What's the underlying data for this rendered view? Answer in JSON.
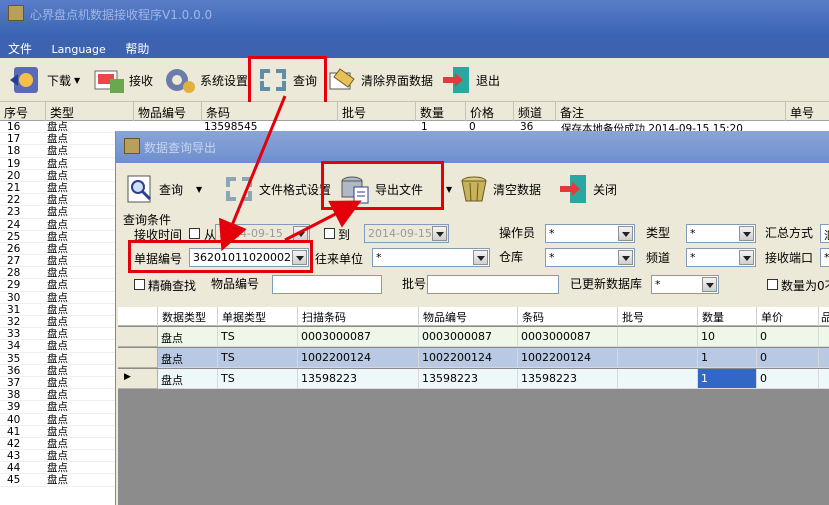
{
  "app": {
    "title": "心界盘点机数据接收程序V1.0.0.0"
  },
  "menu": [
    {
      "label": "文件"
    },
    {
      "label": "Language"
    },
    {
      "label": "帮助"
    }
  ],
  "toolbar": {
    "download": "下载",
    "receive": "接收",
    "settings": "系统设置",
    "query": "查询",
    "clear_ui": "清除界面数据",
    "exit": "退出"
  },
  "main_grid": {
    "columns": [
      "序号",
      "类型",
      "物品编号",
      "条码",
      "批号",
      "数量",
      "价格",
      "频道",
      "备注",
      "单号"
    ],
    "first_row": {
      "barcode": "13598545",
      "qty": "1",
      "price": "0",
      "channel": "36",
      "note": "保存本地备份成功 2014-09-15 15:20"
    },
    "rows": [
      {
        "n": "16",
        "t": "盘点"
      },
      {
        "n": "17",
        "t": "盘点"
      },
      {
        "n": "18",
        "t": "盘点"
      },
      {
        "n": "19",
        "t": "盘点"
      },
      {
        "n": "20",
        "t": "盘点"
      },
      {
        "n": "21",
        "t": "盘点"
      },
      {
        "n": "22",
        "t": "盘点"
      },
      {
        "n": "23",
        "t": "盘点"
      },
      {
        "n": "24",
        "t": "盘点"
      },
      {
        "n": "25",
        "t": "盘点"
      },
      {
        "n": "26",
        "t": "盘点"
      },
      {
        "n": "27",
        "t": "盘点"
      },
      {
        "n": "28",
        "t": "盘点"
      },
      {
        "n": "29",
        "t": "盘点"
      },
      {
        "n": "30",
        "t": "盘点"
      },
      {
        "n": "31",
        "t": "盘点"
      },
      {
        "n": "32",
        "t": "盘点"
      },
      {
        "n": "33",
        "t": "盘点"
      },
      {
        "n": "34",
        "t": "盘点"
      },
      {
        "n": "35",
        "t": "盘点"
      },
      {
        "n": "36",
        "t": "盘点"
      },
      {
        "n": "37",
        "t": "盘点"
      },
      {
        "n": "38",
        "t": "盘点"
      },
      {
        "n": "39",
        "t": "盘点"
      },
      {
        "n": "40",
        "t": "盘点"
      },
      {
        "n": "41",
        "t": "盘点"
      },
      {
        "n": "42",
        "t": "盘点"
      },
      {
        "n": "43",
        "t": "盘点"
      },
      {
        "n": "44",
        "t": "盘点"
      },
      {
        "n": "45",
        "t": "盘点"
      }
    ]
  },
  "child": {
    "title": "数据查询导出",
    "toolbar": {
      "query": "查询",
      "file_format": "文件格式设置",
      "export": "导出文件",
      "clear": "清空数据",
      "close": "关闭"
    },
    "filters": {
      "group_title": "查询条件",
      "recv_time": "接收时间",
      "from": "从",
      "from_date": "2014-09-15",
      "to": "到",
      "to_date": "2014-09-15",
      "operator": "操作员",
      "operator_val": "*",
      "type": "类型",
      "type_val": "*",
      "summary": "汇总方式",
      "summary_val": "汇",
      "doc_no": "单据编号",
      "doc_no_val": "36201011020002",
      "partner": "往来单位",
      "partner_val": "*",
      "warehouse": "仓库",
      "warehouse_val": "*",
      "channel": "频道",
      "channel_val": "*",
      "port": "接收端口",
      "port_val": "*",
      "exact": "精确查找",
      "item_no": "物品编号",
      "batch": "批号",
      "updated_db": "已更新数据库",
      "updated_db_val": "*",
      "qty_zero": "数量为0不"
    },
    "grid": {
      "columns": [
        "数据类型",
        "单据类型",
        "扫描条码",
        "物品编号",
        "条码",
        "批号",
        "数量",
        "单价",
        "品"
      ],
      "rows": [
        {
          "dtype": "盘点",
          "btype": "TS",
          "scan": "0003000087",
          "item": "0003000087",
          "barcode": "0003000087",
          "batch": "",
          "qty": "10",
          "price": "0"
        },
        {
          "dtype": "盘点",
          "btype": "TS",
          "scan": "1002200124",
          "item": "1002200124",
          "barcode": "1002200124",
          "batch": "",
          "qty": "1",
          "price": "0"
        },
        {
          "dtype": "盘点",
          "btype": "TS",
          "scan": "13598223",
          "item": "13598223",
          "barcode": "13598223",
          "batch": "",
          "qty": "1",
          "price": "0"
        }
      ]
    }
  }
}
